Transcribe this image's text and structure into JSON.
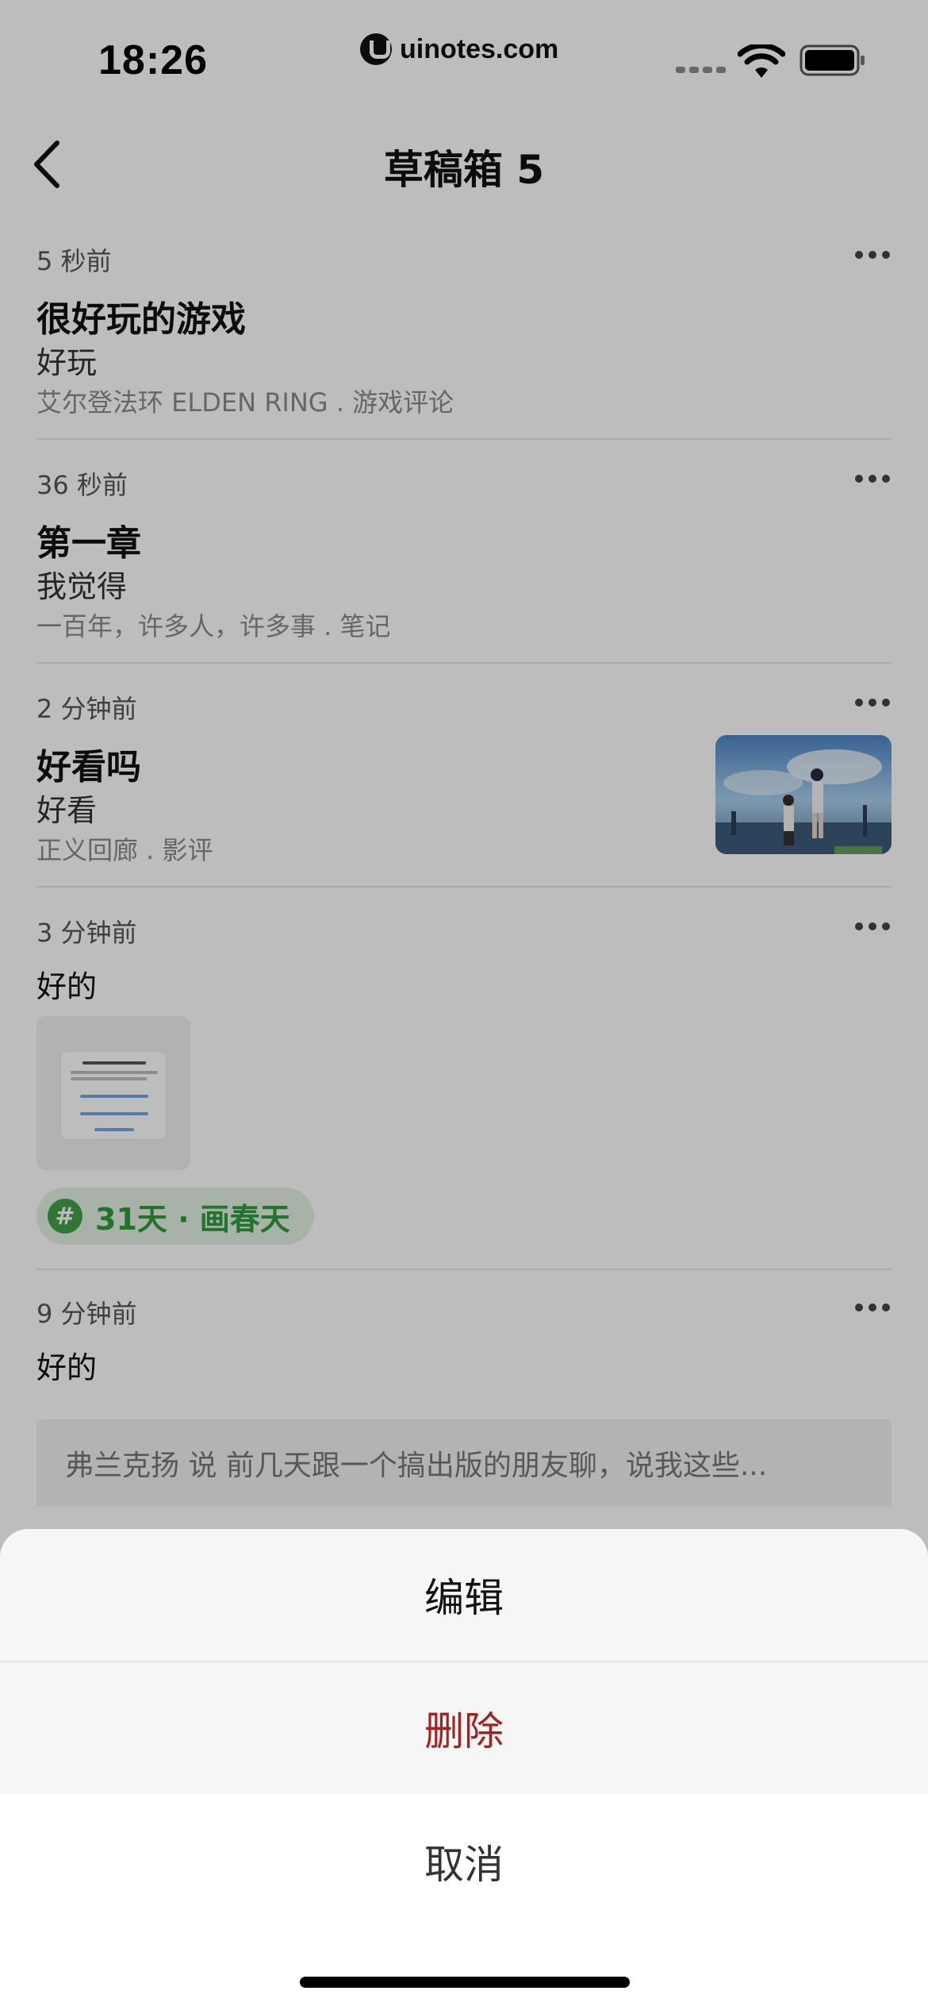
{
  "status_bar": {
    "time": "18:26",
    "url": "uinotes.com"
  },
  "nav": {
    "title": "草稿箱 5"
  },
  "drafts": [
    {
      "time": "5 秒前",
      "title": "很好玩的游戏",
      "body": "好玩",
      "meta": "艾尔登法环 ELDEN RING . 游戏评论"
    },
    {
      "time": "36 秒前",
      "title": "第一章",
      "body": "我觉得",
      "meta": "一百年，许多人，许多事 . 笔记"
    },
    {
      "time": "2 分钟前",
      "title": "好看吗",
      "body": "好看",
      "meta": "正义回廊 . 影评"
    },
    {
      "time": "3 分钟前",
      "body": "好的",
      "topic": "31天 · 画春天"
    },
    {
      "time": "9 分钟前",
      "body": "好的",
      "quote": "弗兰克扬 说 前几天跟一个搞出版的朋友聊，说我这些..."
    }
  ],
  "action_sheet": {
    "edit": "编辑",
    "delete": "删除",
    "cancel": "取消"
  },
  "colors": {
    "delete_red": "#a3211f",
    "topic_green": "#2e9b3a"
  }
}
